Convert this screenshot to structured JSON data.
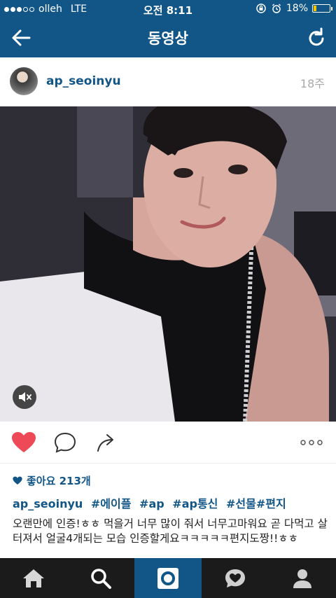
{
  "status_bar": {
    "carrier": "olleh",
    "network": "LTE",
    "time": "오전 8:11",
    "battery": "18%",
    "battery_level": 0.18
  },
  "nav": {
    "title": "동영상",
    "back_icon": "back-arrow-icon",
    "refresh_icon": "refresh-icon"
  },
  "post": {
    "username": "ap_seoinyu",
    "age": "18주",
    "video": {
      "muted": true,
      "mute_icon": "speaker-muted-icon"
    }
  },
  "actions": {
    "like_icon": "heart-icon",
    "liked": true,
    "comment_icon": "comment-icon",
    "share_icon": "share-icon",
    "more_icon": "more-dots-icon"
  },
  "likes": {
    "text": "좋아요 213개"
  },
  "caption": {
    "username": "ap_seoinyu",
    "hashtags": [
      "#에이플",
      "#ap",
      "#ap통신",
      "#선물#편지"
    ],
    "text": "오랜만에 인증!ㅎㅎ 먹을거 너무 많이 줘서 너무고마워요 곧 다먹고 살터져서 얼굴4개되는 모습 인증할게요ㅋㅋㅋㅋㅋ편지도짱!!ㅎㅎ"
  },
  "tabbar": {
    "tabs": [
      {
        "name": "home-icon",
        "active": false
      },
      {
        "name": "search-icon",
        "active": false
      },
      {
        "name": "camera-icon",
        "active": true
      },
      {
        "name": "activity-heart-icon",
        "active": false
      },
      {
        "name": "profile-icon",
        "active": false
      }
    ]
  },
  "colors": {
    "brand": "#125688",
    "like": "#ed4956",
    "tabbar": "#1b1b1b"
  }
}
